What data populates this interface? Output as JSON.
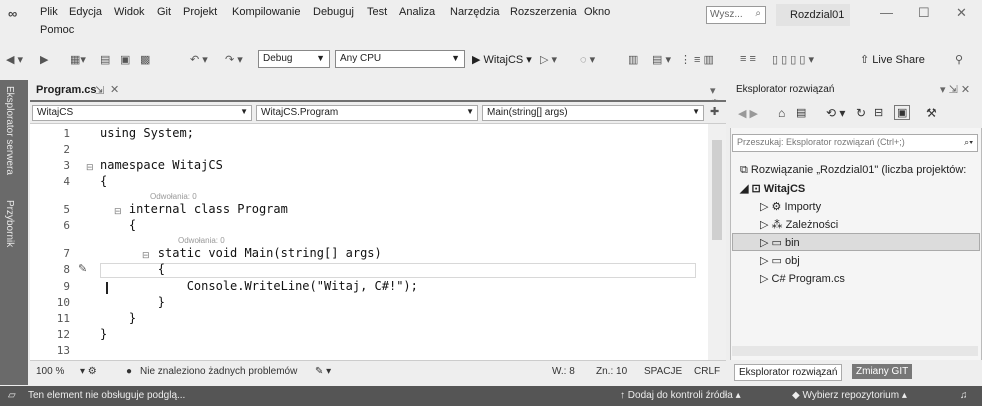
{
  "menu": {
    "logo": "∞",
    "items_row1": [
      "Plik",
      "Edycja",
      "Widok",
      "Git",
      "Projekt",
      "Kompilowanie",
      "Debuguj",
      "Test",
      "Analiza",
      "Narzędzia",
      "Rozszerzenia",
      "Okno"
    ],
    "items_row2": [
      "Pomoc"
    ],
    "search_placeholder": "Wysz...",
    "solution_name": "Rozdzial01"
  },
  "toolbar": {
    "config": "Debug",
    "platform": "Any CPU",
    "run_target": "WitajCS",
    "live_share": "Live Share"
  },
  "sidetabs": [
    "Eksplorator serwera",
    "Przybornik"
  ],
  "editor": {
    "tab_title": "Program.cs",
    "nav_project": "WitajCS",
    "nav_class": "WitajCS.Program",
    "nav_member": "Main(string[] args)",
    "line_numbers": [
      "1",
      "2",
      "3",
      "4",
      "5",
      "6",
      "7",
      "8",
      "9",
      "10",
      "11",
      "12",
      "13"
    ],
    "lines": [
      "using System;",
      "",
      "namespace WitajCS",
      "{",
      "    internal class Program",
      "    {",
      "        static void Main(string[] args)",
      "        {",
      "            Console.WriteLine(\"Witaj, C#!\");",
      "        }",
      "    }",
      "}",
      ""
    ],
    "hint_class": "Odwołania: 0",
    "hint_method": "Odwołania: 0"
  },
  "status": {
    "zoom": "100 %",
    "problems": "Nie znaleziono żadnych problemów",
    "col": "W.: 8",
    "char": "Zn.: 10",
    "spaces": "SPACJE",
    "eol": "CRLF"
  },
  "solution_explorer": {
    "title": "Eksplorator rozwiązań",
    "search_placeholder": "Przeszukaj: Eksplorator rozwiązań (Ctrl+;)",
    "solution_label": "Rozwiązanie „Rozdzial01\" (liczba projektów:",
    "project": "WitajCS",
    "items": [
      "Importy",
      "Zależności",
      "bin",
      "obj",
      "Program.cs"
    ],
    "tab_active": "Eksplorator rozwiązań",
    "tab_other": "Zmiany GIT"
  },
  "bottom": {
    "message": "Ten element nie obsługuje podglą...",
    "source_control": "Dodaj do kontroli źródła",
    "repo": "Wybierz repozytorium"
  }
}
